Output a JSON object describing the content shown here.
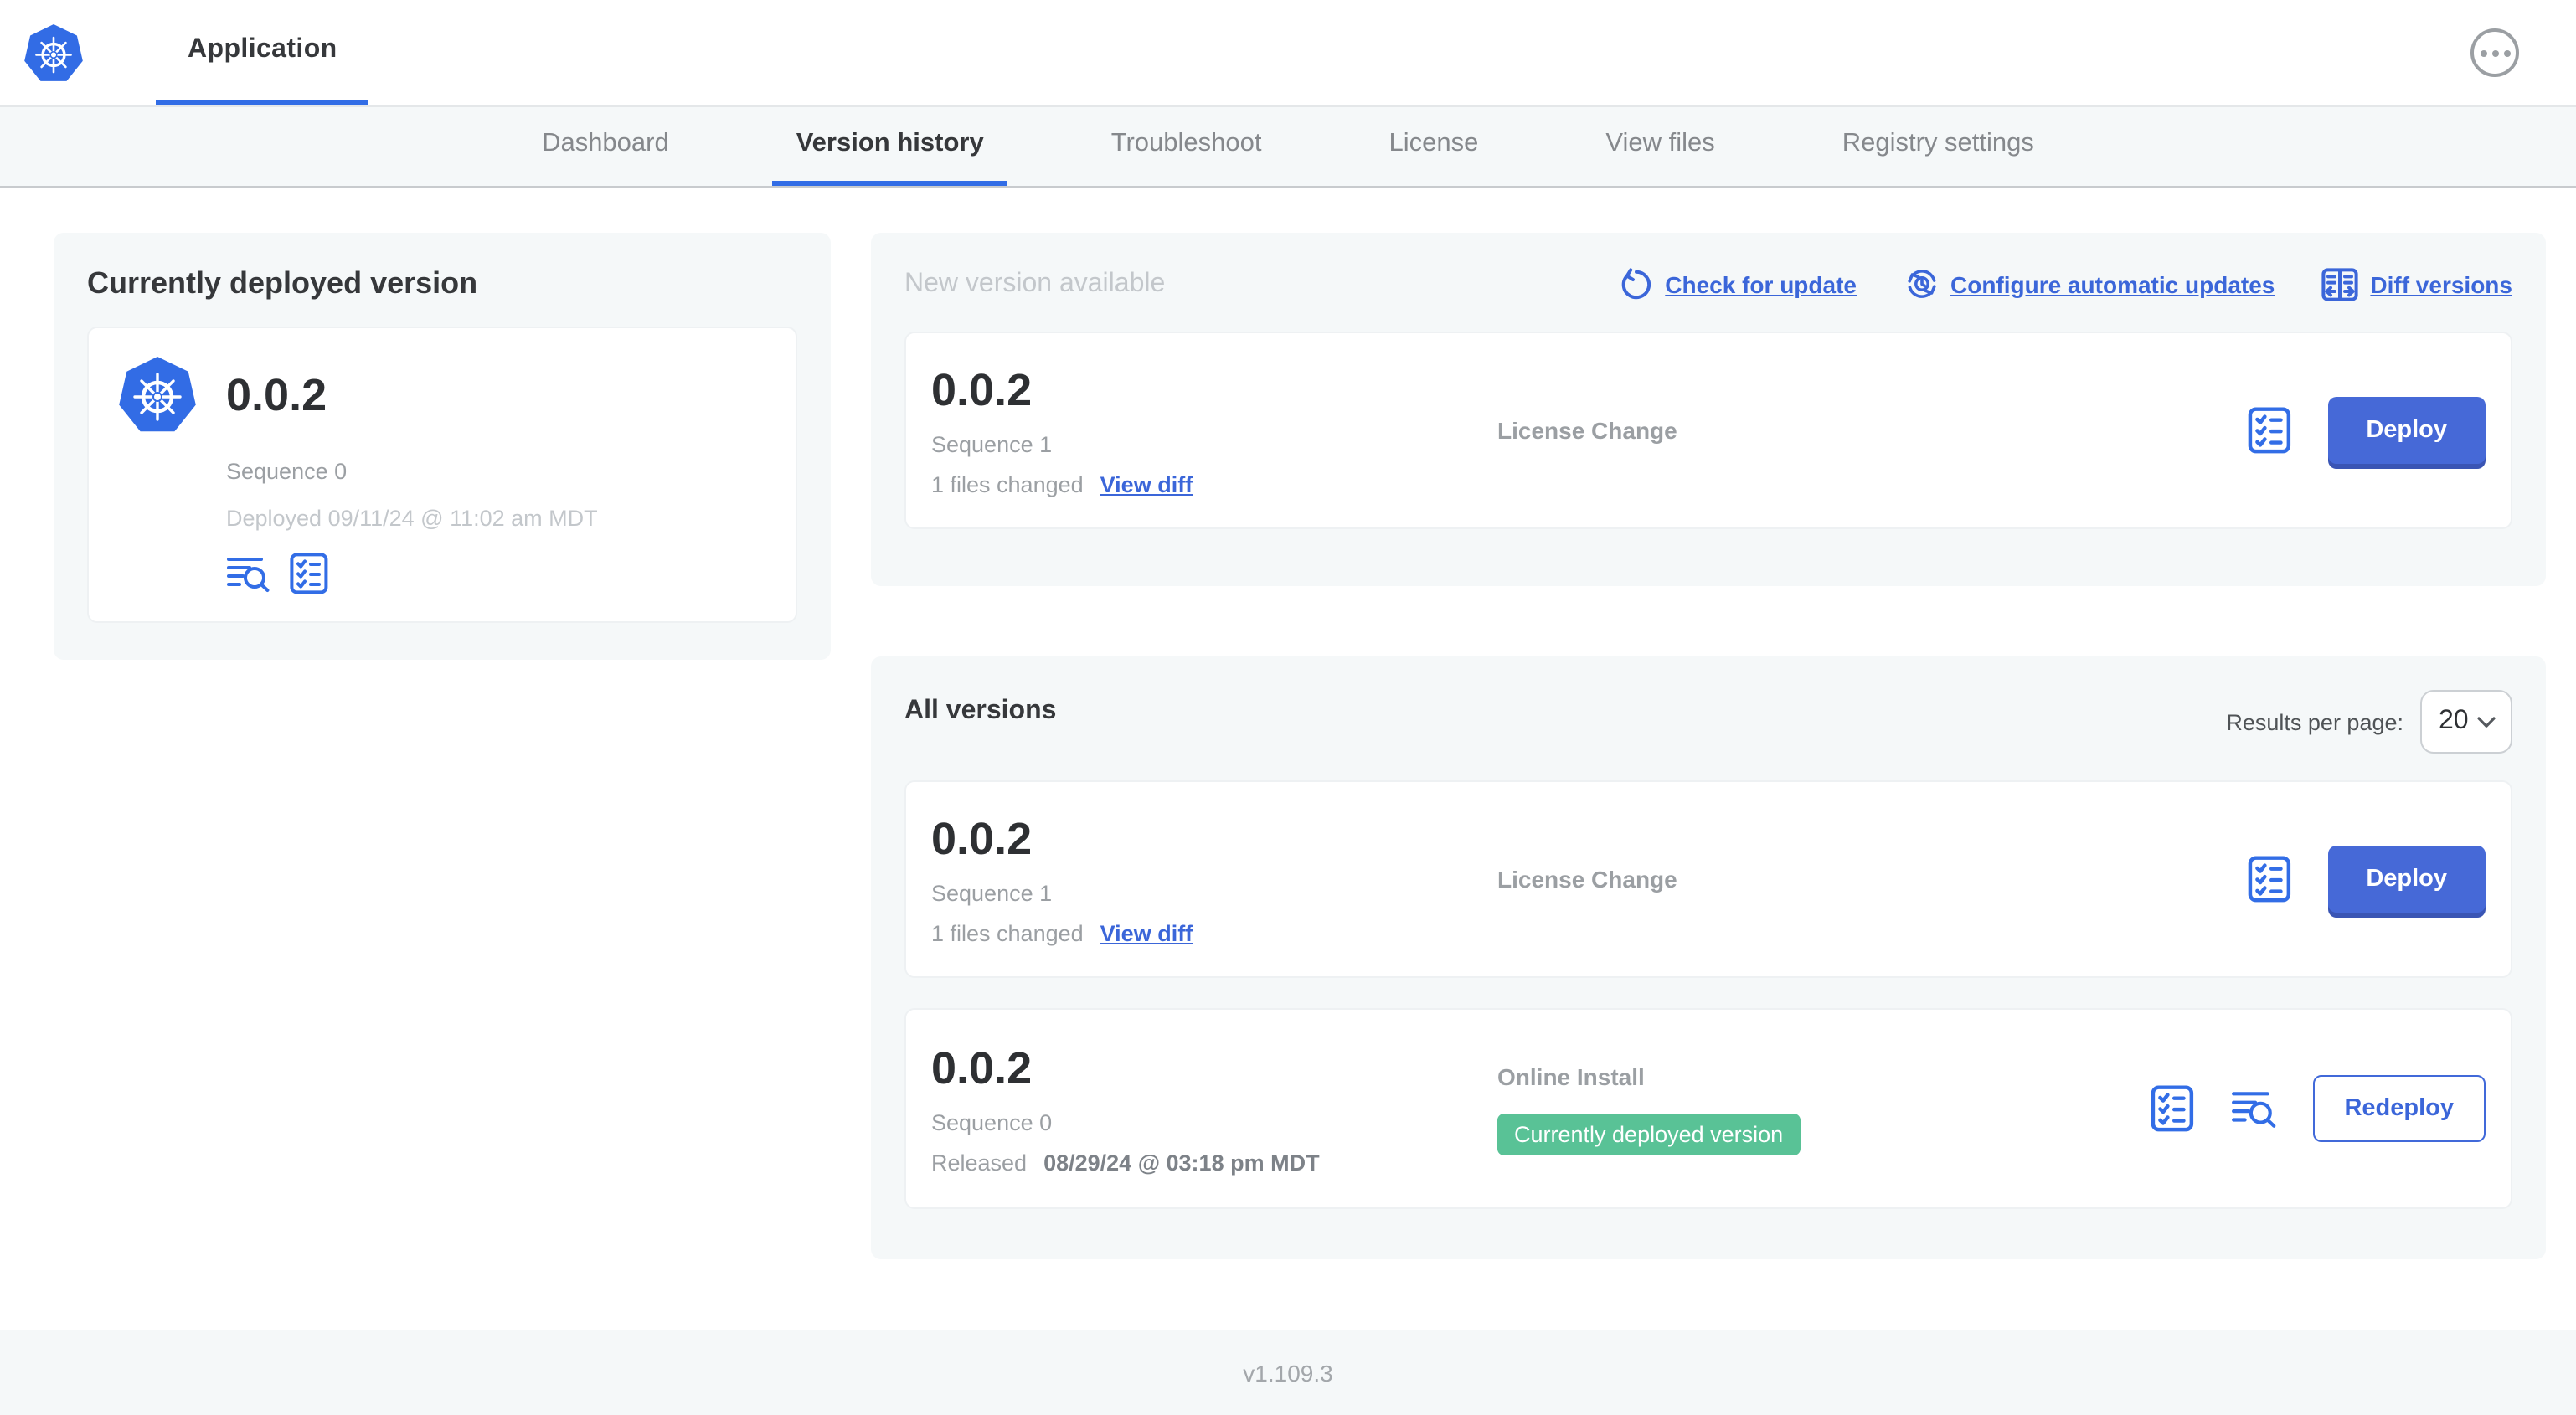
{
  "colors": {
    "accent_blue": "#326de6",
    "link_blue": "#3b66d9",
    "button_blue": "#4669d7",
    "badge_green": "#59c296",
    "section_gray": "#f5f8f9"
  },
  "icons": {
    "logo": "kubernetes-logo",
    "more": "ellipsis-circle",
    "logs": "view-logs",
    "checklist": "preflight-checklist",
    "refresh": "check-update-refresh",
    "auto_update": "clock-cycle",
    "diff": "diff-columns",
    "chevron": "chevron-down"
  },
  "header": {
    "app_title": "Application"
  },
  "nav": {
    "tabs": [
      {
        "label": "Dashboard",
        "active": false
      },
      {
        "label": "Version history",
        "active": true
      },
      {
        "label": "Troubleshoot",
        "active": false
      },
      {
        "label": "License",
        "active": false
      },
      {
        "label": "View files",
        "active": false
      },
      {
        "label": "Registry settings",
        "active": false
      }
    ]
  },
  "current_version_card": {
    "title": "Currently deployed version",
    "version": "0.0.2",
    "sequence": "Sequence 0",
    "deployed": "Deployed 09/11/24 @ 11:02 am MDT"
  },
  "new_version_section": {
    "title": "New version available",
    "actions": [
      {
        "label": "Check for update"
      },
      {
        "label": "Configure automatic updates"
      },
      {
        "label": "Diff versions"
      }
    ],
    "row": {
      "version": "0.0.2",
      "sequence": "Sequence 1",
      "files_changed": "1 files changed",
      "view_diff": "View diff",
      "source": "License Change",
      "action_label": "Deploy"
    }
  },
  "all_versions_section": {
    "title": "All versions",
    "results_per_page_label": "Results per page:",
    "results_per_page_value": "20",
    "rows": [
      {
        "version": "0.0.2",
        "sequence": "Sequence 1",
        "files_changed": "1 files changed",
        "view_diff": "View diff",
        "source": "License Change",
        "action_label": "Deploy"
      },
      {
        "version": "0.0.2",
        "sequence": "Sequence 0",
        "released_prefix": "Released",
        "released_date": "08/29/24 @ 03:18 pm MDT",
        "source": "Online Install",
        "badge": "Currently deployed version",
        "action_label": "Redeploy"
      }
    ]
  },
  "footer": {
    "version": "v1.109.3"
  }
}
